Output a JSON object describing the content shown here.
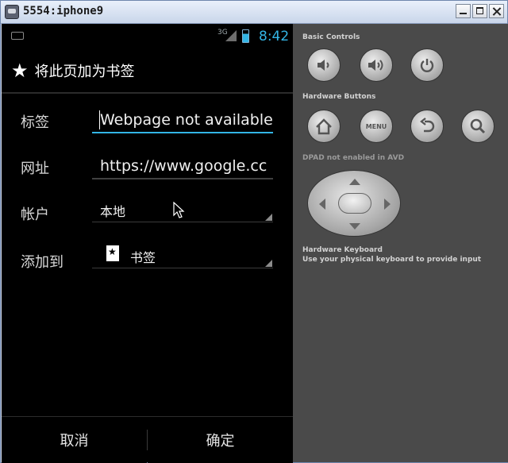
{
  "window": {
    "title": "5554:iphone9"
  },
  "status_bar": {
    "network": "3G",
    "time": "8:42"
  },
  "dialog": {
    "title": "将此页加为书签",
    "rows": [
      {
        "label": "标签",
        "value": "Webpage not available"
      },
      {
        "label": "网址",
        "value": "https://www.google.cc"
      },
      {
        "label": "帐户",
        "value": "本地"
      },
      {
        "label": "添加到",
        "value": "书签"
      }
    ],
    "cancel_label": "取消",
    "ok_label": "确定"
  },
  "controls": {
    "basic_label": "Basic Controls",
    "hardware_buttons_label": "Hardware Buttons",
    "menu_label": "MENU",
    "dpad_label": "DPAD not enabled in AVD",
    "keyboard_label": "Hardware Keyboard",
    "keyboard_hint": "Use your physical keyboard to provide input"
  },
  "colors": {
    "accent": "#33b5e5",
    "panel_bg": "#4a4a4a",
    "phone_bg": "#000000"
  }
}
